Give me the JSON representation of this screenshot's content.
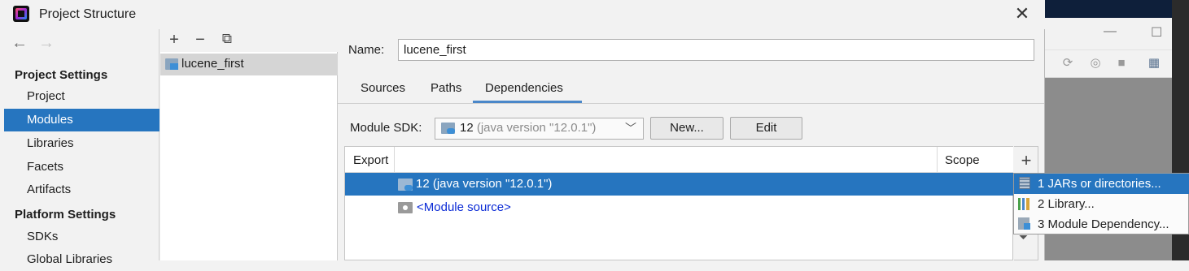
{
  "window": {
    "title": "Project Structure",
    "close_glyph": "✕"
  },
  "nav": {
    "back_glyph": "←",
    "forward_glyph": "→",
    "project_settings_header": "Project Settings",
    "project_items": [
      "Project",
      "Modules",
      "Libraries",
      "Facets",
      "Artifacts"
    ],
    "platform_settings_header": "Platform Settings",
    "platform_items": [
      "SDKs",
      "Global Libraries"
    ],
    "selected": "Modules"
  },
  "modules": {
    "toolbar": {
      "add": "+",
      "remove": "−",
      "copy": "⧉"
    },
    "items": [
      "lucene_first"
    ]
  },
  "module": {
    "name_label": "Name:",
    "name_value": "lucene_first",
    "tabs": [
      "Sources",
      "Paths",
      "Dependencies"
    ],
    "active_tab": "Dependencies",
    "sdk_label": "Module SDK:",
    "sdk_value_main": "12",
    "sdk_value_detail": "(java version \"12.0.1\")",
    "new_button": "New...",
    "edit_button": "Edit"
  },
  "dependencies": {
    "columns": {
      "export": "Export",
      "scope": "Scope"
    },
    "rows": [
      {
        "label": "12 (java version \"12.0.1\")",
        "selected": true
      },
      {
        "label": "<Module source>",
        "selected": false
      }
    ],
    "add_glyph": "+",
    "down_glyph": "⏷"
  },
  "add_menu": {
    "items": [
      "1  JARs or directories...",
      "2  Library...",
      "3  Module Dependency..."
    ],
    "selected_index": 0
  },
  "background_window": {
    "minimize_glyph": "—",
    "maximize_glyph": "☐",
    "toolbar_icons": [
      "run-config-icon",
      "debug-icon",
      "coverage-icon",
      "stop-icon",
      "project-structure-icon",
      "run-icon"
    ]
  },
  "colors": {
    "selection": "#2675bf",
    "link": "#0b2bd6",
    "tab_underline": "#4a87c9"
  }
}
